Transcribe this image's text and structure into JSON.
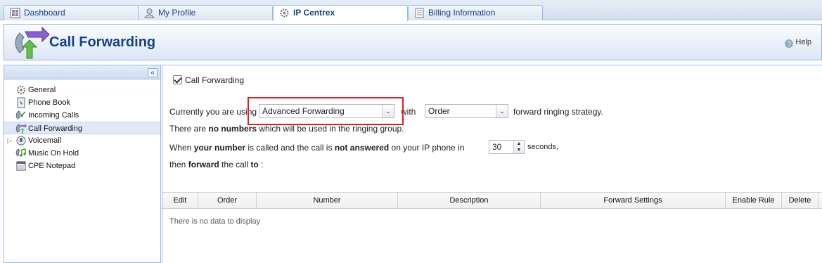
{
  "tabs": [
    {
      "label": "Dashboard",
      "icon": "dashboard-icon",
      "active": false
    },
    {
      "label": "My Profile",
      "icon": "user-icon",
      "active": false
    },
    {
      "label": "IP Centrex",
      "icon": "gear-icon",
      "active": true
    },
    {
      "label": "Billing Information",
      "icon": "document-icon",
      "active": false
    }
  ],
  "header": {
    "title": "Call Forwarding",
    "help_label": "Help",
    "logo_icon": "call-forward-icon"
  },
  "sidebar": {
    "items": [
      {
        "label": "General",
        "icon": "gear-icon"
      },
      {
        "label": "Phone Book",
        "icon": "phone-book-icon"
      },
      {
        "label": "Incoming Calls",
        "icon": "incoming-calls-icon"
      },
      {
        "label": "Call Forwarding",
        "icon": "call-forward-icon",
        "selected": true
      },
      {
        "label": "Voicemail",
        "icon": "voicemail-icon",
        "expandable": true
      },
      {
        "label": "Music On Hold",
        "icon": "music-icon"
      },
      {
        "label": "CPE Notepad",
        "icon": "notepad-icon"
      }
    ]
  },
  "main": {
    "checkbox_label": "Call Forwarding",
    "checkbox_checked": true,
    "line1_prefix": "Currently you are using",
    "forwarding_mode": "Advanced Forwarding",
    "line1_with": "with",
    "strategy": "Order",
    "line1_suffix": "forward ringing strategy.",
    "line2_a": "There are",
    "line2_b": "no numbers",
    "line2_c": "which will be used in the ringing group.",
    "line3_a": "When",
    "line3_b": "your number",
    "line3_c": "is called and the call is",
    "line3_d": "not answered",
    "line3_e": "on your IP phone in",
    "seconds_value": "30",
    "seconds_label": "seconds,",
    "line4_a": "then",
    "line4_b": "forward",
    "line4_c": "the call",
    "line4_d": "to",
    "line4_e": ":"
  },
  "grid": {
    "columns": [
      "Edit",
      "Order",
      "Number",
      "Description",
      "Forward Settings",
      "Enable Rule",
      "Delete"
    ],
    "empty_text": "There is no data to display"
  },
  "colors": {
    "accent": "#15428b",
    "border": "#99bbe8",
    "highlight": "#e02020"
  }
}
